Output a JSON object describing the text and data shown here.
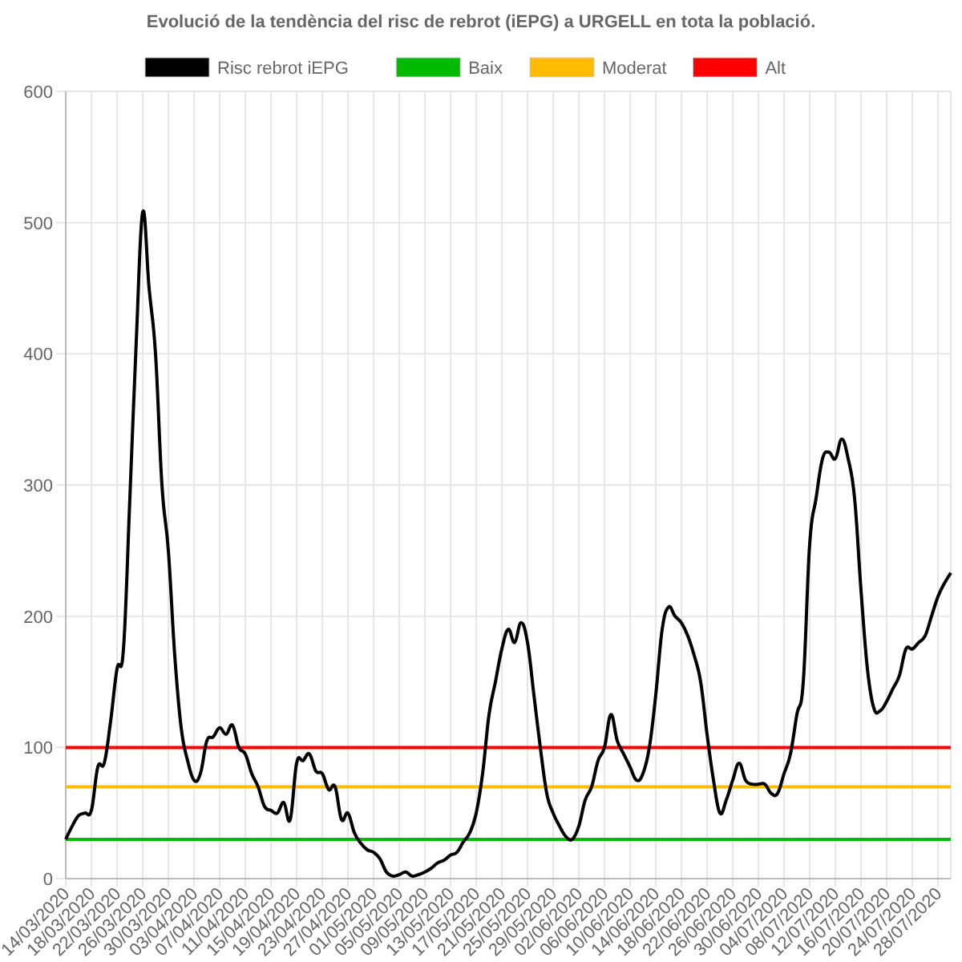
{
  "chart_data": {
    "type": "line",
    "title": "Evolució de la tendència del risc de rebrot (iEPG) a URGELL en tota la població.",
    "ylim": [
      0,
      600
    ],
    "yticks": [
      0,
      100,
      200,
      300,
      400,
      500,
      600
    ],
    "grid": true,
    "legend": true,
    "categories": [
      "14/03/2020",
      null,
      null,
      null,
      "18/03/2020",
      null,
      null,
      null,
      "22/03/2020",
      null,
      null,
      null,
      "26/03/2020",
      null,
      null,
      null,
      "30/03/2020",
      null,
      null,
      null,
      "03/04/2020",
      null,
      null,
      null,
      "07/04/2020",
      null,
      null,
      null,
      "11/04/2020",
      null,
      null,
      null,
      "15/04/2020",
      null,
      null,
      null,
      "19/04/2020",
      null,
      null,
      null,
      "23/04/2020",
      null,
      null,
      null,
      "27/04/2020",
      null,
      null,
      null,
      "01/05/2020",
      null,
      null,
      null,
      "05/05/2020",
      null,
      null,
      null,
      "09/05/2020",
      null,
      null,
      null,
      "13/05/2020",
      null,
      null,
      null,
      "17/05/2020",
      null,
      null,
      null,
      "21/05/2020",
      null,
      null,
      null,
      "25/05/2020",
      null,
      null,
      null,
      "29/05/2020",
      null,
      null,
      null,
      "02/06/2020",
      null,
      null,
      null,
      "06/06/2020",
      null,
      null,
      null,
      "10/06/2020",
      null,
      null,
      null,
      "14/06/2020",
      null,
      null,
      null,
      "18/06/2020",
      null,
      null,
      null,
      "22/06/2020",
      null,
      null,
      null,
      "26/06/2020",
      null,
      null,
      null,
      "30/06/2020",
      null,
      null,
      null,
      "04/07/2020",
      null,
      null,
      null,
      "08/07/2020",
      null,
      null,
      null,
      "12/07/2020",
      null,
      null,
      null,
      "16/07/2020",
      null,
      null,
      null,
      "20/07/2020",
      null,
      null,
      null,
      "24/07/2020",
      null,
      null,
      null,
      "28/07/2020",
      null,
      null
    ],
    "series": [
      {
        "name": "Risc rebrot iEPG",
        "color": "#000000",
        "values": [
          30,
          40,
          48,
          50,
          52,
          85,
          88,
          120,
          160,
          175,
          290,
          410,
          508,
          450,
          400,
          300,
          250,
          170,
          115,
          90,
          75,
          80,
          105,
          108,
          115,
          110,
          117,
          100,
          95,
          80,
          70,
          55,
          52,
          50,
          58,
          45,
          88,
          90,
          95,
          82,
          80,
          68,
          70,
          45,
          50,
          35,
          27,
          22,
          20,
          15,
          5,
          2,
          3,
          5,
          2,
          3,
          5,
          8,
          12,
          14,
          18,
          20,
          28,
          35,
          50,
          80,
          125,
          150,
          175,
          190,
          180,
          195,
          180,
          140,
          100,
          65,
          50,
          40,
          32,
          30,
          40,
          60,
          70,
          90,
          100,
          125,
          105,
          95,
          85,
          75,
          80,
          100,
          140,
          190,
          207,
          200,
          195,
          185,
          170,
          150,
          110,
          75,
          50,
          60,
          75,
          88,
          75,
          72,
          72,
          72,
          65,
          65,
          80,
          95,
          125,
          150,
          255,
          290,
          320,
          325,
          320,
          335,
          320,
          290,
          220,
          160,
          130,
          128,
          135,
          145,
          155,
          175,
          175,
          180,
          185,
          200,
          215,
          225,
          233
        ]
      },
      {
        "name": "Baix",
        "color": "#00bb00",
        "values": [
          30,
          30,
          30,
          30,
          30,
          30,
          30,
          30,
          30,
          30,
          30,
          30,
          30,
          30,
          30,
          30,
          30,
          30,
          30,
          30,
          30,
          30,
          30,
          30,
          30,
          30,
          30,
          30,
          30,
          30,
          30,
          30,
          30,
          30,
          30,
          30,
          30,
          30,
          30,
          30,
          30,
          30,
          30,
          30,
          30,
          30,
          30,
          30,
          30,
          30,
          30,
          30,
          30,
          30,
          30,
          30,
          30,
          30,
          30,
          30,
          30,
          30,
          30,
          30,
          30,
          30,
          30,
          30,
          30,
          30,
          30,
          30,
          30,
          30,
          30,
          30,
          30,
          30,
          30,
          30,
          30,
          30,
          30,
          30,
          30,
          30,
          30,
          30,
          30,
          30,
          30,
          30,
          30,
          30,
          30,
          30,
          30,
          30,
          30,
          30,
          30,
          30,
          30,
          30,
          30,
          30,
          30,
          30,
          30,
          30,
          30,
          30,
          30,
          30,
          30,
          30,
          30,
          30,
          30,
          30,
          30,
          30,
          30,
          30,
          30,
          30,
          30,
          30,
          30,
          30,
          30,
          30,
          30,
          30,
          30,
          30,
          30,
          30,
          30
        ]
      },
      {
        "name": "Moderat",
        "color": "#ffbb00",
        "values": [
          70,
          70,
          70,
          70,
          70,
          70,
          70,
          70,
          70,
          70,
          70,
          70,
          70,
          70,
          70,
          70,
          70,
          70,
          70,
          70,
          70,
          70,
          70,
          70,
          70,
          70,
          70,
          70,
          70,
          70,
          70,
          70,
          70,
          70,
          70,
          70,
          70,
          70,
          70,
          70,
          70,
          70,
          70,
          70,
          70,
          70,
          70,
          70,
          70,
          70,
          70,
          70,
          70,
          70,
          70,
          70,
          70,
          70,
          70,
          70,
          70,
          70,
          70,
          70,
          70,
          70,
          70,
          70,
          70,
          70,
          70,
          70,
          70,
          70,
          70,
          70,
          70,
          70,
          70,
          70,
          70,
          70,
          70,
          70,
          70,
          70,
          70,
          70,
          70,
          70,
          70,
          70,
          70,
          70,
          70,
          70,
          70,
          70,
          70,
          70,
          70,
          70,
          70,
          70,
          70,
          70,
          70,
          70,
          70,
          70,
          70,
          70,
          70,
          70,
          70,
          70,
          70,
          70,
          70,
          70,
          70,
          70,
          70,
          70,
          70,
          70,
          70,
          70,
          70,
          70,
          70,
          70,
          70,
          70,
          70,
          70,
          70,
          70,
          70
        ]
      },
      {
        "name": "Alt",
        "color": "#ff0000",
        "values": [
          100,
          100,
          100,
          100,
          100,
          100,
          100,
          100,
          100,
          100,
          100,
          100,
          100,
          100,
          100,
          100,
          100,
          100,
          100,
          100,
          100,
          100,
          100,
          100,
          100,
          100,
          100,
          100,
          100,
          100,
          100,
          100,
          100,
          100,
          100,
          100,
          100,
          100,
          100,
          100,
          100,
          100,
          100,
          100,
          100,
          100,
          100,
          100,
          100,
          100,
          100,
          100,
          100,
          100,
          100,
          100,
          100,
          100,
          100,
          100,
          100,
          100,
          100,
          100,
          100,
          100,
          100,
          100,
          100,
          100,
          100,
          100,
          100,
          100,
          100,
          100,
          100,
          100,
          100,
          100,
          100,
          100,
          100,
          100,
          100,
          100,
          100,
          100,
          100,
          100,
          100,
          100,
          100,
          100,
          100,
          100,
          100,
          100,
          100,
          100,
          100,
          100,
          100,
          100,
          100,
          100,
          100,
          100,
          100,
          100,
          100,
          100,
          100,
          100,
          100,
          100,
          100,
          100,
          100,
          100,
          100,
          100,
          100,
          100,
          100,
          100,
          100,
          100,
          100,
          100,
          100,
          100,
          100,
          100,
          100,
          100,
          100,
          100,
          100
        ]
      }
    ]
  }
}
